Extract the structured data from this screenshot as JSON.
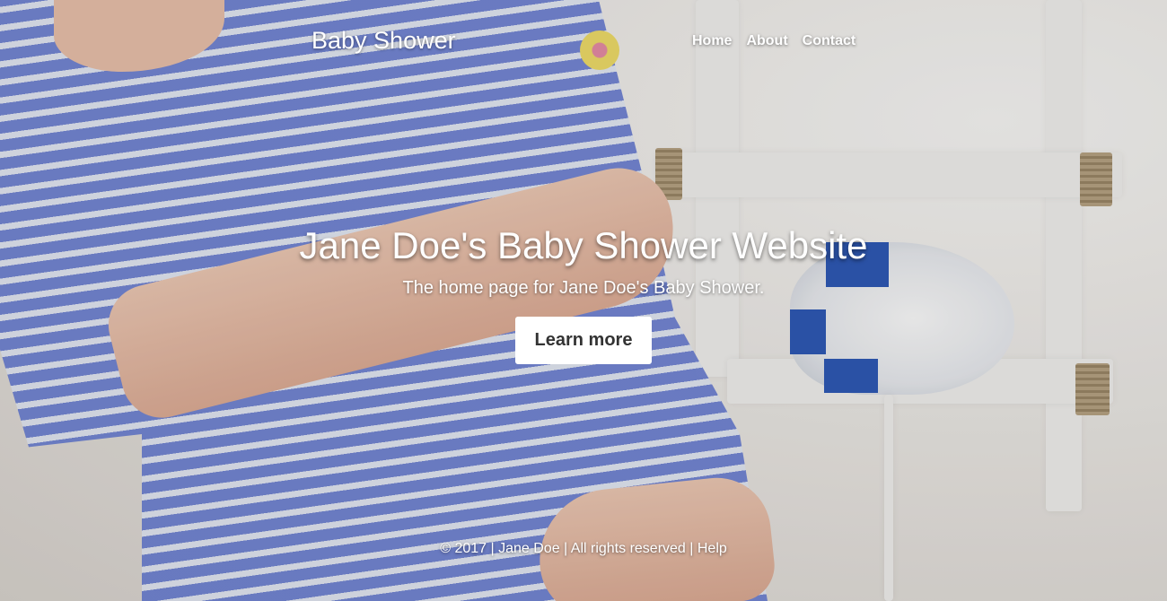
{
  "header": {
    "brand": "Baby Shower",
    "nav": [
      "Home",
      "About",
      "Contact"
    ]
  },
  "hero": {
    "title": "Jane Doe's Baby Shower Website",
    "subtitle": "The home page for Jane Doe's Baby Shower.",
    "button_label": "Learn more"
  },
  "footer": {
    "copyright": "© 2017 |",
    "author_link": "Jane Doe",
    "sep1": "|",
    "rights": "All rights reserved",
    "sep2": "|",
    "help_link": "Help"
  },
  "colors": {
    "text": "#ffffff",
    "button_bg": "#ffffff",
    "button_text": "#333333",
    "dress_stripe": "#6f83d6"
  }
}
